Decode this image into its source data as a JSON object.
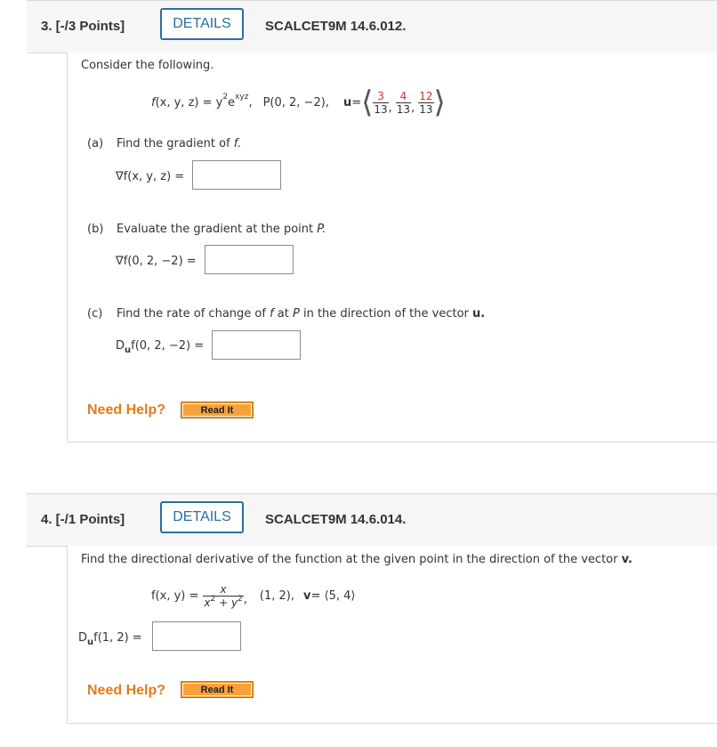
{
  "q3": {
    "points": "3. [-/3 Points]",
    "details_label": "DETAILS",
    "code": "SCALCET9M 14.6.012.",
    "intro": "Consider the following.",
    "function_f": "f",
    "function_args": "(x, y, z) = y",
    "exp2": "2",
    "e": "e",
    "exp_xyz": "xyz",
    "comma1": ",",
    "point": "P(0, 2, −2),",
    "u_label": "u",
    "u_eq": " =",
    "u_vec": [
      {
        "num": "3",
        "den": "13"
      },
      {
        "num": "4",
        "den": "13"
      },
      {
        "num": "12",
        "den": "13"
      }
    ],
    "part_a_label": "(a)",
    "part_a_text": "Find the gradient of ",
    "part_a_f": "f.",
    "grad_a": "∇f(x, y, z) =",
    "part_b_label": "(b)",
    "part_b_text": "Evaluate the gradient at the point ",
    "part_b_p": "P.",
    "grad_b": "∇f(0, 2, −2) =",
    "part_c_label": "(c)",
    "part_c_text1": "Find the rate of change of ",
    "part_c_f": "f",
    "part_c_text2": " at ",
    "part_c_p": "P",
    "part_c_text3": " in the direction of the vector ",
    "part_c_u": "u.",
    "du_D": "D",
    "du_sub": "u",
    "du_rest": "f(0, 2, −2) =",
    "need_help": "Need Help?",
    "read_it": "Read It"
  },
  "q4": {
    "points": "4. [-/1 Points]",
    "details_label": "DETAILS",
    "code": "SCALCET9M 14.6.014.",
    "intro1": "Find the directional derivative of the function at the given point in the direction of the vector ",
    "intro_v": "v.",
    "f_label": "f(x, y) =",
    "frac_num": "x",
    "frac_den_x": "x",
    "frac_den_y": "y",
    "frac_den_mid": " + ",
    "exp2": "2",
    "point": "(1, 2),",
    "v_label": "v",
    "v_eq": " = ⟨5, 4⟩",
    "du_D": "D",
    "du_sub": "u",
    "du_rest": "f(1, 2) =",
    "need_help": "Need Help?",
    "read_it": "Read It"
  },
  "colors": {
    "accent": "#2a6f9e",
    "help": "#e27b1a",
    "read_it_bg": "#f39c2b",
    "header_bg": "#f6f6f6",
    "fraction_num": "#c0392b"
  }
}
